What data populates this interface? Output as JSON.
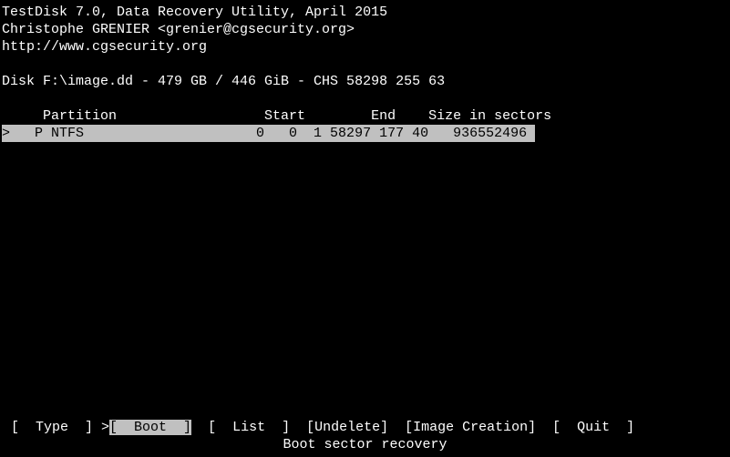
{
  "header": {
    "title": "TestDisk 7.0, Data Recovery Utility, April 2015",
    "author": "Christophe GRENIER <grenier@cgsecurity.org>",
    "url": "http://www.cgsecurity.org"
  },
  "disk": {
    "line": "Disk F:\\image.dd - 479 GB / 446 GiB - CHS 58298 255 63"
  },
  "table": {
    "header": "     Partition                  Start        End    Size in sectors",
    "rows": [
      ">   P NTFS                     0   0  1 58297 177 40   936552496 "
    ]
  },
  "menu": {
    "type": "[  Type  ]",
    "cursor": ">",
    "boot": "[  Boot  ]",
    "list": "  [  List  ]  ",
    "undelete": "[Undelete]  ",
    "image": "[Image Creation]",
    "quit": "  [  Quit  ]"
  },
  "description": "Boot sector recovery"
}
